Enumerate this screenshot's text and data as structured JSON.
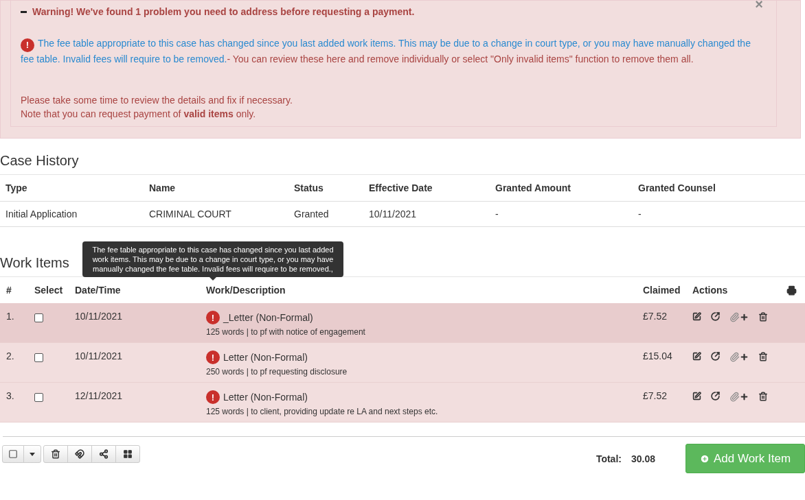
{
  "alert": {
    "title": "Warning! We've found 1 problem you need to address before requesting a payment.",
    "close": "×",
    "problem_icon": "!",
    "problem_text": "The fee table appropriate to this case has changed since you last added work items. This may be due to a change in court type, or you may have manually changed the fee table. Invalid fees will require to be removed.",
    "problem_hint": "- You can review these here and remove individually or select \"Only invalid items\" function to remove them all.",
    "notes": [
      "Please take some time to review the details and fix if necessary.",
      "Note that you can request payment of **valid items** only."
    ]
  },
  "case_history": {
    "title": "Case History",
    "columns": [
      "Type",
      "Name",
      "Status",
      "Effective Date",
      "Granted Amount",
      "Granted Counsel"
    ],
    "rows": [
      [
        "Initial Application",
        "CRIMINAL COURT",
        "Granted",
        "10/11/2021",
        "-",
        "-"
      ]
    ]
  },
  "work_items": {
    "title": "Work Items",
    "columns": [
      "#",
      "Select",
      "Date/Time",
      "Work/Description",
      "Claimed",
      "Actions"
    ],
    "tooltip": "The fee table appropriate to this case has changed since you last added work items. This may be due to a change in court type, or you may have manually changed the fee table. Invalid fees will require to be removed.,",
    "rows": [
      {
        "number": "1.",
        "checked": false,
        "date": "10/11/2021",
        "invalid": true,
        "invalid_icon": "!",
        "title": "_Letter (Non-Formal)",
        "detail": "125 words | to pf with notice of engagement",
        "claimed": "£7.52",
        "hovered": true
      },
      {
        "number": "2.",
        "checked": false,
        "date": "10/11/2021",
        "invalid": true,
        "invalid_icon": "!",
        "title": "Letter (Non-Formal)",
        "detail": "250 words | to pf requesting disclosure",
        "claimed": "£15.04",
        "hovered": false
      },
      {
        "number": "3.",
        "checked": false,
        "date": "12/11/2021",
        "invalid": true,
        "invalid_icon": "!",
        "title": "Letter (Non-Formal)",
        "detail": "125 words | to client, providing update re LA and next steps etc.",
        "claimed": "£7.52",
        "hovered": false
      }
    ]
  },
  "footer": {
    "total_label": "Total:",
    "total": "30.08",
    "add_button": "Add Work Item"
  }
}
